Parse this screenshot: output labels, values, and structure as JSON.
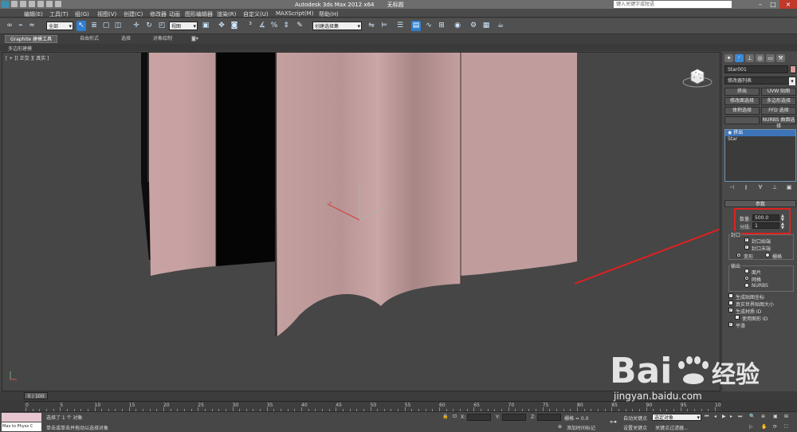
{
  "titlebar": {
    "app_title": "Autodesk 3ds Max  2012 x64",
    "doc_title": "无标题",
    "search_placeholder": "键入关键字或短语"
  },
  "menubar": {
    "items": [
      "编辑(E)",
      "工具(T)",
      "组(G)",
      "视图(V)",
      "创建(C)",
      "修改器",
      "动画",
      "图形编辑器",
      "渲染(R)",
      "自定义(U)",
      "MAXScript(M)",
      "帮助(H)"
    ]
  },
  "toolbar": {
    "selection_filter": "全部",
    "ref_coord": "视图",
    "named_selection": "创建选择集"
  },
  "ribbon": {
    "tabs": [
      "Graphite 建模工具",
      "自由形式",
      "选择",
      "对象绘制"
    ],
    "subtitle": "多边形建模"
  },
  "viewport": {
    "label": "[ + ][ 正交 ][ 真实 ]"
  },
  "command_panel": {
    "object_name": "Star001",
    "object_color": "#d99a9a",
    "modifier_list": "修改器列表",
    "modifier_buttons": [
      "挤出",
      "UVW 贴图",
      "修改面选择",
      "多边形选择",
      "体积选择",
      "FFD 选择",
      "",
      "NURBS 曲面选择"
    ],
    "stack": [
      "挤出",
      "Star"
    ],
    "parameters_title": "参数",
    "amount_label": "数量:",
    "amount_value": "500.0",
    "segments_label": "分段:",
    "segments_value": "1",
    "capping_title": "封口",
    "cap_start": "封口始端",
    "cap_end": "封口末端",
    "morph": "变形",
    "grid": "栅格",
    "output_title": "输出",
    "patch": "面片",
    "mesh": "网格",
    "nurbs": "NURBS",
    "gen_map_coords": "生成贴图坐标",
    "real_world_map": "真实世界贴图大小",
    "gen_material_ids": "生成材质 ID",
    "use_shape_ids": "使用图形 ID",
    "smooth": "平滑"
  },
  "timeline": {
    "frame_display": "0 / 100",
    "ticks": [
      "0",
      "5",
      "10",
      "15",
      "20",
      "25",
      "30",
      "35",
      "40",
      "45",
      "50",
      "55",
      "60",
      "65",
      "70",
      "75",
      "80",
      "85",
      "90",
      "95",
      "100"
    ]
  },
  "statusbar": {
    "maxscript_text": "Max to Physx C",
    "selection_msg": "选择了 1 个 对象",
    "prompt_msg": "单击或单击并拖动以选择对象",
    "x_label": "X:",
    "y_label": "Y:",
    "z_label": "Z:",
    "grid_label": "栅格 = 0.0",
    "add_time_tag": "添加时间标记",
    "auto_key": "自动关键点",
    "set_key": "设置关键点",
    "selected_dropdown": "选定对象",
    "key_filters": "关键点过滤器..."
  },
  "watermark": {
    "brand": "Bai",
    "brand_cn": "经验",
    "url": "jingyan.baidu.com"
  },
  "colors": {
    "highlight_red": "#e02020",
    "object_pink": "#c9a3a3",
    "accent_blue": "#2f7fd0"
  }
}
